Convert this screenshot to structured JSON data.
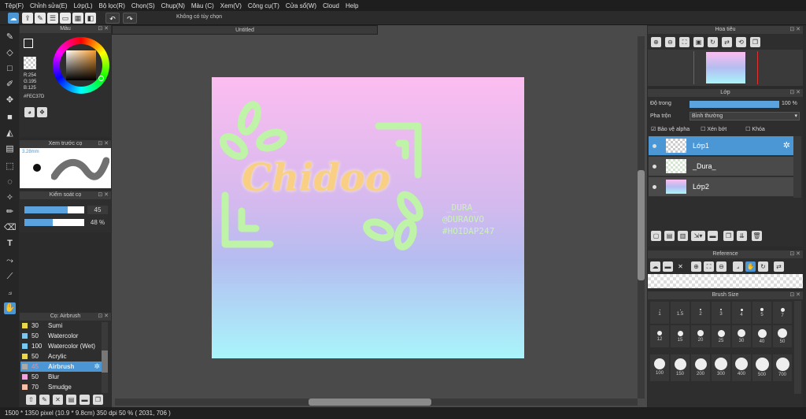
{
  "menu": [
    "Tệp(F)",
    "Chỉnh sửa(E)",
    "Lớp(L)",
    "Bộ lọc(R)",
    "Chọn(S)",
    "Chụp(N)",
    "Màu (C)",
    "Xem(V)",
    "Công cụ(T)",
    "Cửa sổ(W)",
    "Cloud",
    "Help"
  ],
  "toolbar": {
    "no_option": "Không có tùy chọn"
  },
  "color_panel": {
    "title": "Màu",
    "r": "R:254",
    "g": "G:195",
    "b": "B:125",
    "hex": "#FEC37D",
    "fg": "#FEC37D"
  },
  "preview_panel": {
    "title": "Xem trước cọ",
    "size": "3.28mm"
  },
  "control_panel": {
    "title": "Kiểm soát cọ",
    "size_value": "45",
    "opacity_value": "48 %",
    "size_fraction": 0.72,
    "opacity_fraction": 0.48
  },
  "brush_list": {
    "title": "Cọ: Airbrush",
    "items": [
      {
        "num": "30",
        "name": "Sumi",
        "color": "#e8d84a"
      },
      {
        "num": "50",
        "name": "Watercolor",
        "color": "#7ac8f0"
      },
      {
        "num": "100",
        "name": "Watercolor (Wet)",
        "color": "#7ac8f0"
      },
      {
        "num": "50",
        "name": "Acrylic",
        "color": "#e8d84a"
      },
      {
        "num": "45",
        "name": "Airbrush",
        "color": "#aaaaaa"
      },
      {
        "num": "50",
        "name": "Blur",
        "color": "#f4a0e0"
      },
      {
        "num": "70",
        "name": "Smudge",
        "color": "#f6c0a8"
      }
    ]
  },
  "document": {
    "tab_title": "Untitled"
  },
  "artwork": {
    "logo": "Chidoo",
    "credit1": "_DURA_",
    "credit2": "@DURAOVO",
    "credit3": "#HOIDAP247"
  },
  "navigator": {
    "title": "Hoa tiêu"
  },
  "layers_panel": {
    "title": "Lớp",
    "opacity_label": "Độ trong",
    "opacity_value": "100 %",
    "blend_label": "Pha trộn",
    "blend_value": "Bình thường",
    "protect_alpha": "Bảo vệ alpha",
    "clipping": "Xén bớt",
    "lock": "Khóa",
    "layers": [
      {
        "name": "Lớp1"
      },
      {
        "name": "_Dura_"
      },
      {
        "name": "Lớp2"
      }
    ]
  },
  "reference_panel": {
    "title": "Reference"
  },
  "brush_size_panel": {
    "title": "Brush Size",
    "row1": [
      "1",
      "1.5",
      "2",
      "3",
      "4",
      "5",
      "7"
    ],
    "row2": [
      "12",
      "15",
      "20",
      "25",
      "30",
      "40",
      "50"
    ],
    "row3": [
      "100",
      "150",
      "200",
      "300",
      "400",
      "500",
      "700"
    ]
  },
  "status": {
    "text": "1500 * 1350 pixel  (10.9 * 9.8cm)  350 dpi  50 %  ( 2031, 706 )"
  }
}
